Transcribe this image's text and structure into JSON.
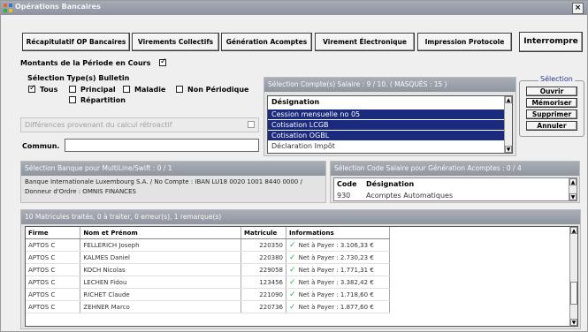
{
  "window": {
    "title": "Opérations Bancaires",
    "close_label": "×"
  },
  "toolbar": {
    "buttons": [
      "Récapitulatif OP Bancaires",
      "Virements Collectifs",
      "Génération Acomptes",
      "Virement Électronique",
      "Impression Protocole"
    ],
    "interrompre": "Interrompre"
  },
  "period": {
    "label": "Montants de la Période en Cours",
    "checked": true
  },
  "bulletin": {
    "label": "Sélection Type(s) Bulletin",
    "options": [
      {
        "label": "Tous",
        "checked": true
      },
      {
        "label": "Principal",
        "checked": false
      },
      {
        "label": "Maladie",
        "checked": false
      },
      {
        "label": "Non Périodique",
        "checked": false
      },
      {
        "label": "Répartition",
        "checked": false
      }
    ]
  },
  "retro": {
    "label": "Différences provenant du calcul rétroactif"
  },
  "commun": {
    "label": "Commun.",
    "value": ""
  },
  "comptes": {
    "header": "Sélection Compte(s) Salaire : 9 / 10. ( MASQUÉS : 15 )",
    "column": "Désignation",
    "rows": [
      "Cession mensuelle no 05",
      "Cotisation LCGB",
      "Cotisation OGBL",
      "Déclaration Impôt"
    ]
  },
  "selection": {
    "legend": "Sélection",
    "ouvrir": "Ouvrir",
    "memoriser": "Mémoriser",
    "supprimer": "Supprimer",
    "annuler": "Annuler"
  },
  "banque": {
    "header": "Sélection Banque pour MultiLine/Swift : 0 / 1",
    "text": "Banque Internationale Luxembourg S.A. / No Compte : IBAN LU18 0020 1001 8440 0000 / Donneur d'Ordre : OMNIS FINANCES"
  },
  "code_salaire": {
    "header": "Sélection Code Salaire pour Génération Acomptes : 0 / 4",
    "columns": [
      "Code",
      "Désignation"
    ],
    "rows": [
      {
        "code": "930",
        "designation": "Acomptes Automatiques"
      }
    ]
  },
  "matricules": {
    "header": "10 Matricules traités, 0 à traiter, 0 erreur(s), 1 remarque(s)",
    "columns": [
      "Firme",
      "Nom et Prénom",
      "Matricule",
      "Informations"
    ],
    "rows": [
      {
        "firme": "APTOS C",
        "nom": "FELLERICH Joseph",
        "matricule": "220350",
        "info": "Net à Payer : 3.106,33 €"
      },
      {
        "firme": "APTOS C",
        "nom": "KALMES Daniel",
        "matricule": "220380",
        "info": "Net à Payer : 2.730,23 €"
      },
      {
        "firme": "APTOS C",
        "nom": "KOCH Nicolas",
        "matricule": "229058",
        "info": "Net à Payer : 1.771,31 €"
      },
      {
        "firme": "APTOS C",
        "nom": "LECHEN Fidou",
        "matricule": "123456",
        "info": "Net à Payer : 3.382,42 €"
      },
      {
        "firme": "APTOS C",
        "nom": "RICHET Claude",
        "matricule": "221090",
        "info": "Net à Payer : 1.718,60 €"
      },
      {
        "firme": "APTOS C",
        "nom": "ZEHNER Marco",
        "matricule": "220736",
        "info": "Net à Payer : 1.877,60 €"
      }
    ]
  }
}
